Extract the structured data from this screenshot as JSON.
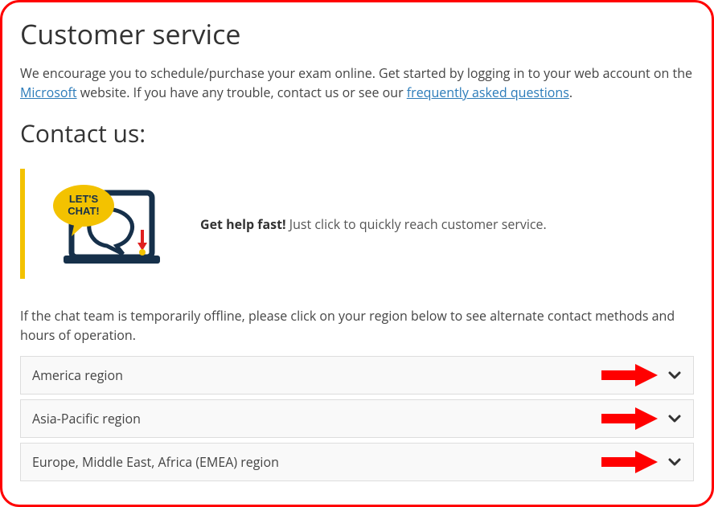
{
  "page_title": "Customer service",
  "intro_part1": "We encourage you to schedule/purchase your exam online. Get started by logging in to your web account on the ",
  "intro_link1": "Microsoft",
  "intro_part2": " website. If you have any trouble, contact us or see our ",
  "intro_link2": "frequently asked questions",
  "intro_part3": ".",
  "contact_heading": "Contact us:",
  "chat_bubble_text": "LET'S CHAT!",
  "chat_bold": "Get help fast!",
  "chat_rest": " Just click to quickly reach customer service.",
  "offline_note": "If the chat team is temporarily offline, please click on your region below to see alternate contact methods and hours of operation.",
  "regions": [
    {
      "label": "America region"
    },
    {
      "label": "Asia-Pacific region"
    },
    {
      "label": "Europe, Middle East, Africa (EMEA) region"
    }
  ]
}
